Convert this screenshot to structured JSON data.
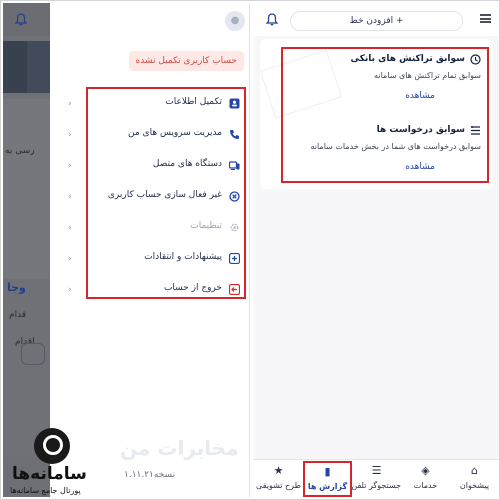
{
  "colors": {
    "accent": "#2446a8",
    "highlight_red": "#d6262c",
    "warning_badge_bg": "#fde8e6",
    "warning_badge_text": "#d24a45"
  },
  "left_screen": {
    "background_app": {
      "text_fragments": [
        "رسی به",
        "وجا",
        "قدام",
        "اقدام"
      ]
    },
    "drawer": {
      "profile_badge": "حساب کاربری تکمیل نشده",
      "menu_items": [
        {
          "label": "تکمیل اطلاعات",
          "icon": "user-card-icon"
        },
        {
          "label": "مدیریت سرویس های من",
          "icon": "phone-icon"
        },
        {
          "label": "دستگاه های متصل",
          "icon": "devices-icon"
        },
        {
          "label": "غیر فعال سازی حساب کاربری",
          "icon": "deactivate-icon"
        },
        {
          "label": "تنظیمات",
          "icon": "settings-icon",
          "disabled": true
        },
        {
          "label": "پیشنهادات و انتقادات",
          "icon": "feedback-icon"
        },
        {
          "label": "خروج از حساب",
          "icon": "logout-icon"
        }
      ],
      "watermark": "مخابرات من",
      "version": "نسخه۱.۱۱.۲۱"
    },
    "site_logo": {
      "name": "سامانه‌ها",
      "tagline": "پورتال جامع سامانه‌ها"
    }
  },
  "right_screen": {
    "topbar": {
      "add_line": "+ افزودن خط",
      "bell_icon": "bell-icon",
      "menu_icon": "hamburger-menu-icon"
    },
    "reports": [
      {
        "title": "سوابق تراکنش های بانکی",
        "description": "سوابق تمام تراکنش های سامانه",
        "link": "مشاهده",
        "icon": "transaction-history-icon"
      },
      {
        "title": "سوابق درخواست ها",
        "description": "سوابق درخواست های شما در بخش خدمات سامانه",
        "link": "مشاهده",
        "icon": "request-history-icon"
      }
    ],
    "bottom_nav": [
      {
        "label": "پیشخوان",
        "icon": "home-icon"
      },
      {
        "label": "خدمات",
        "icon": "layers-icon"
      },
      {
        "label": "جستجوگر تلفن",
        "icon": "phone-search-icon"
      },
      {
        "label": "گزارش ها",
        "icon": "chart-icon",
        "active": true
      },
      {
        "label": "طرح تشویقی",
        "icon": "star-icon"
      }
    ]
  }
}
